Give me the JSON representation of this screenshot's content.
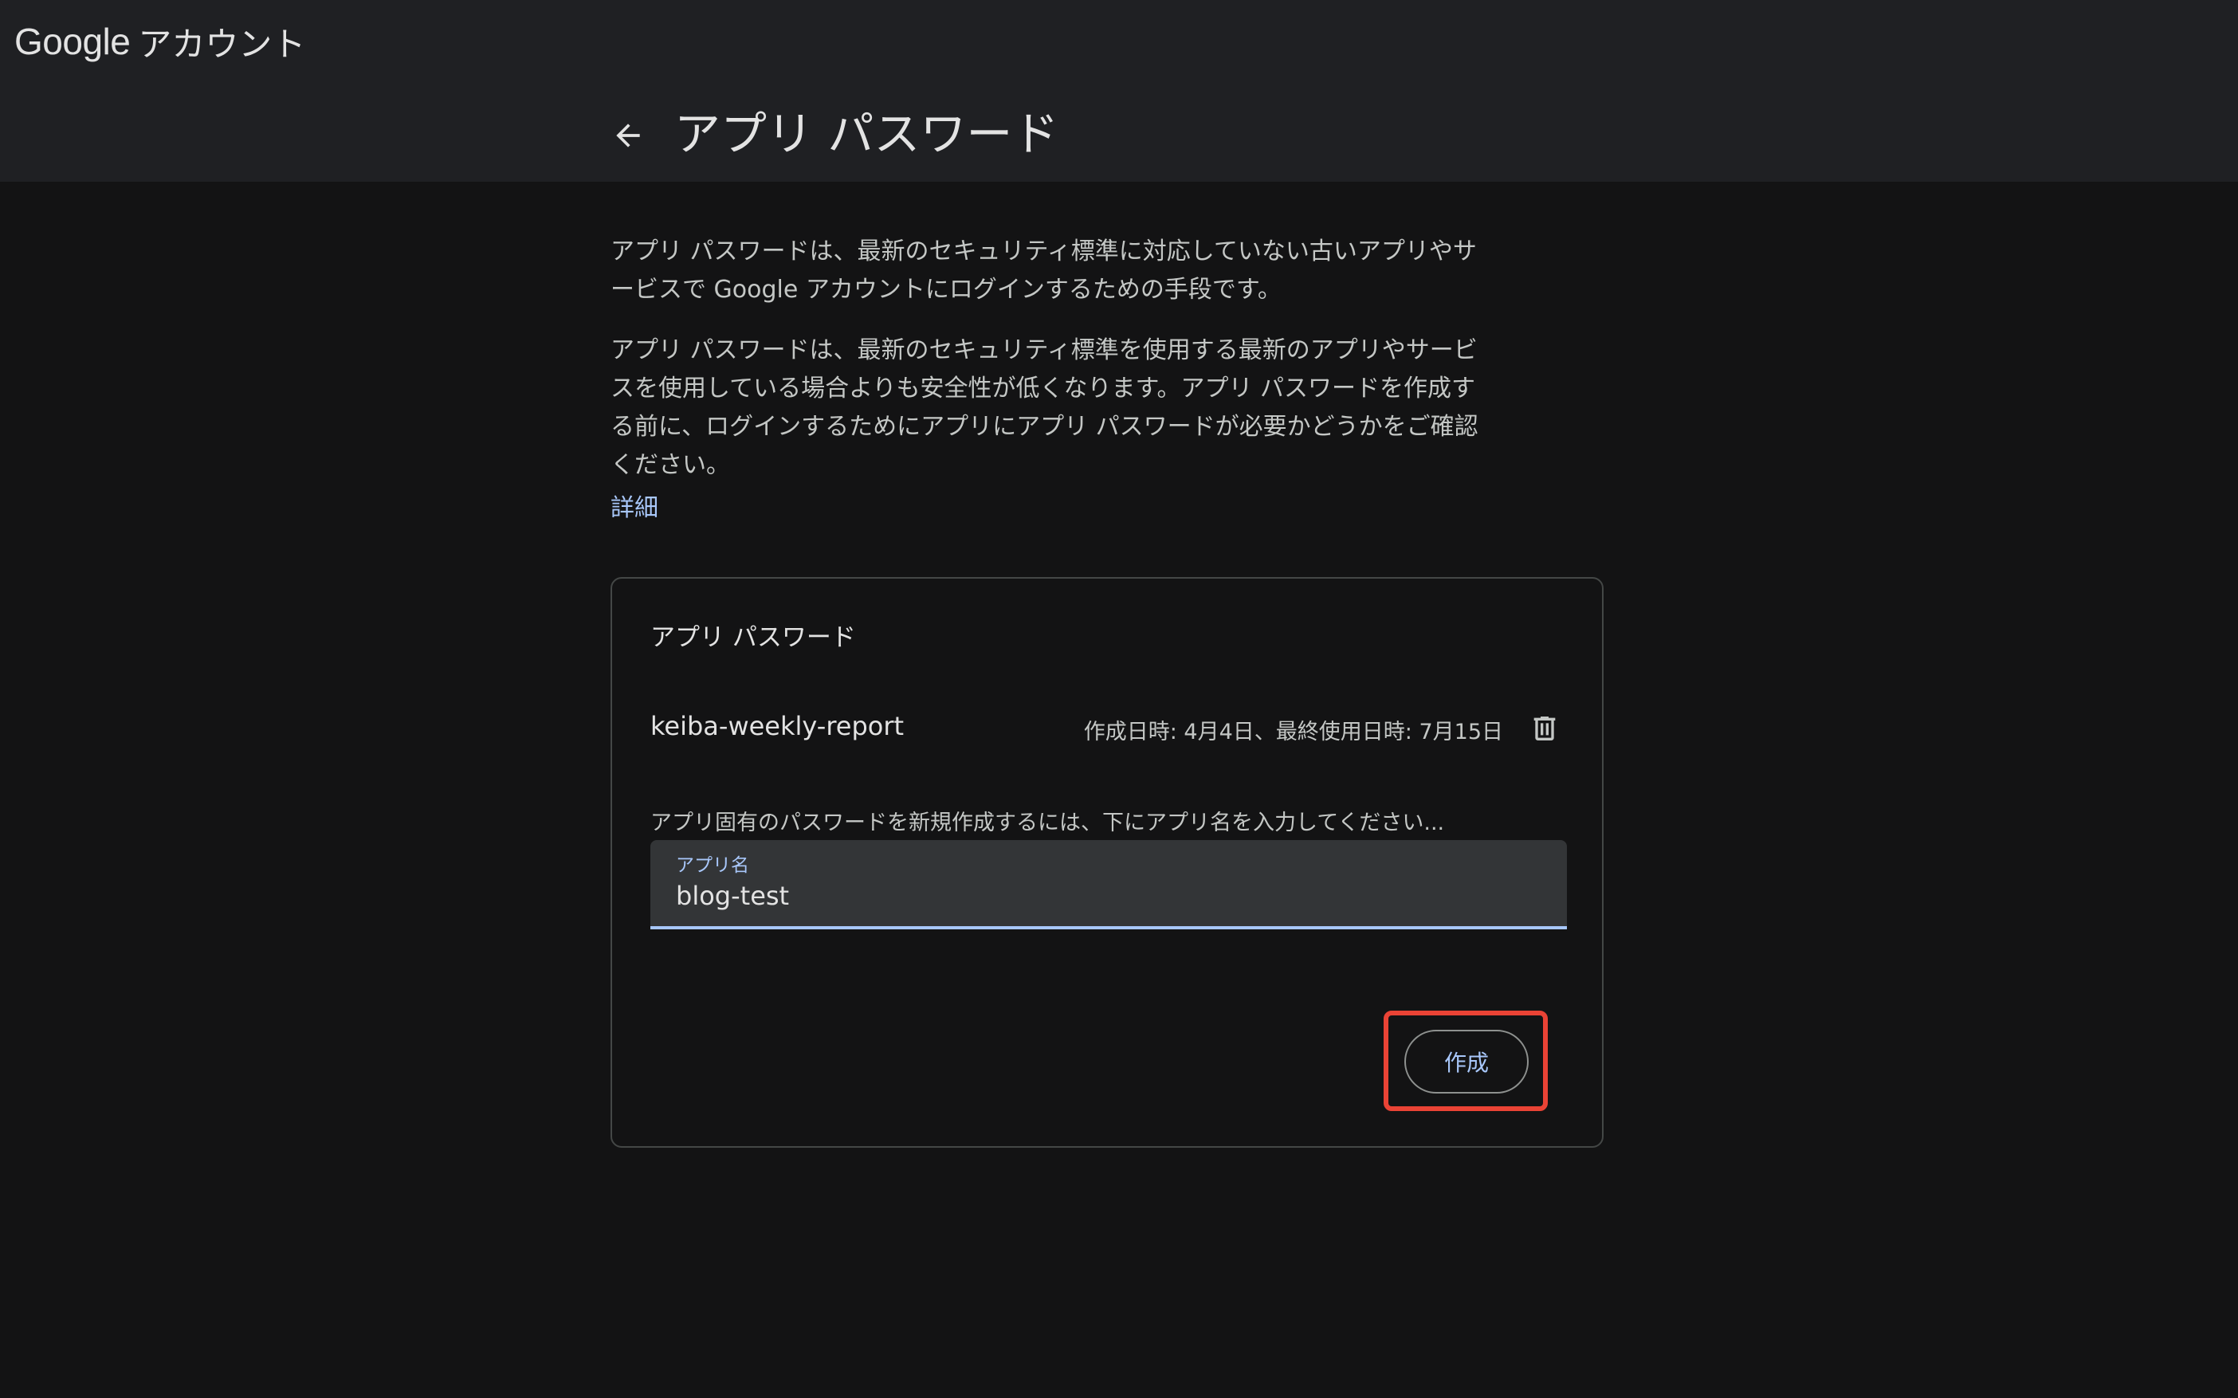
{
  "header": {
    "brand_google": "Google",
    "brand_account": "アカウント",
    "title": "アプリ パスワード",
    "back_icon": "arrow-back-icon"
  },
  "intro": {
    "paragraph1": "アプリ パスワードは、最新のセキュリティ標準に対応していない古いアプリやサービスで Google アカウントにログインするための手段です。",
    "paragraph2": "アプリ パスワードは、最新のセキュリティ標準を使用する最新のアプリやサービスを使用している場合よりも安全性が低くなります。アプリ パスワードを作成する前に、ログインするためにアプリにアプリ パスワードが必要かどうかをご確認ください。",
    "details_link": "詳細"
  },
  "card": {
    "title": "アプリ パスワード",
    "passwords": [
      {
        "name": "keiba-weekly-report",
        "meta": "作成日時: 4月4日、最終使用日時: 7月15日",
        "delete_icon": "trash-icon"
      }
    ],
    "hint": "アプリ固有のパスワードを新規作成するには、下にアプリ名を入力してください...",
    "field": {
      "label": "アプリ名",
      "value": "blog-test"
    },
    "create_label": "作成"
  },
  "colors": {
    "background": "#131314",
    "header_background": "#1f2023",
    "accent": "#a8c7fa",
    "highlight": "#ea4335",
    "text": "#e3e3e3"
  }
}
